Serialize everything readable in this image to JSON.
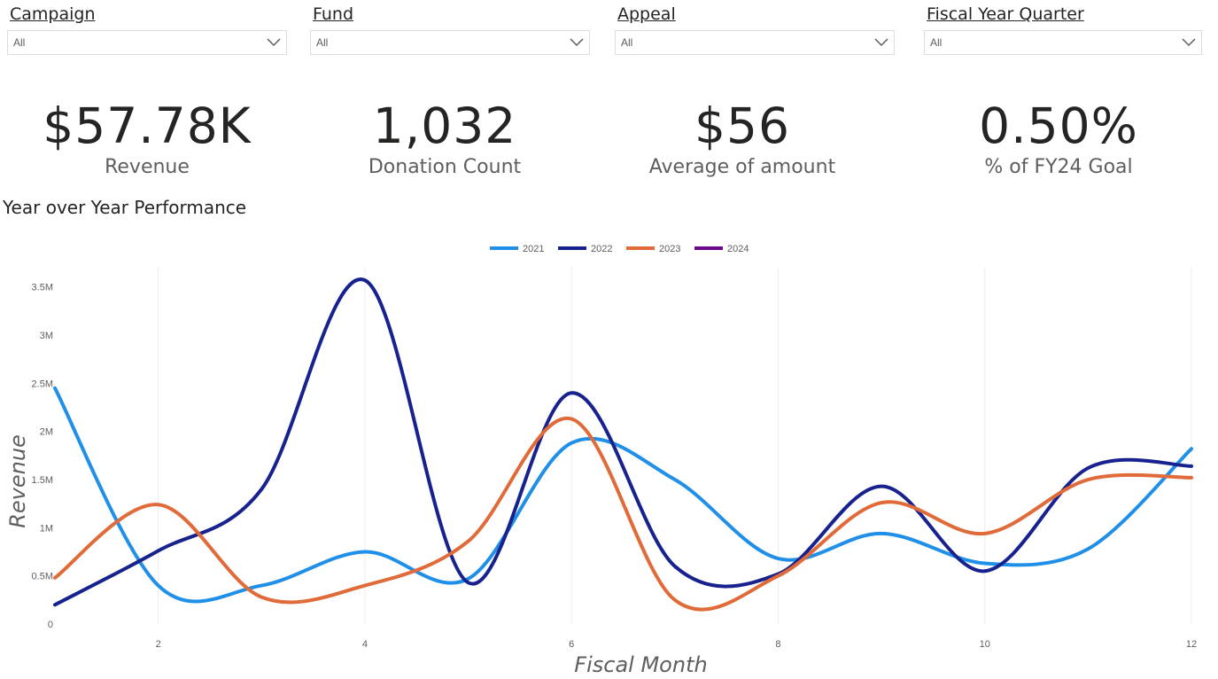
{
  "filters": [
    {
      "label": "Campaign",
      "value": "All"
    },
    {
      "label": "Fund",
      "value": "All"
    },
    {
      "label": "Appeal",
      "value": "All"
    },
    {
      "label": "Fiscal Year Quarter",
      "value": "All"
    }
  ],
  "kpis": [
    {
      "value": "$57.78K",
      "label": "Revenue"
    },
    {
      "value": "1,032",
      "label": "Donation Count"
    },
    {
      "value": "$56",
      "label": "Average of amount"
    },
    {
      "value": "0.50%",
      "label": "% of FY24 Goal"
    }
  ],
  "chart_title": "Year over Year Performance",
  "colors": {
    "2021": "#1f8fe8",
    "2022": "#17228f",
    "2023": "#e06a38",
    "2024": "#6b0a8a"
  },
  "chart_data": {
    "type": "line",
    "x": [
      1,
      2,
      3,
      4,
      5,
      6,
      7,
      8,
      9,
      10,
      11,
      12
    ],
    "xticks": [
      "2",
      "4",
      "6",
      "8",
      "10",
      "12"
    ],
    "xtick_values": [
      2,
      4,
      6,
      8,
      10,
      12
    ],
    "yticks": [
      "0",
      "0.5M",
      "1M",
      "1.5M",
      "2M",
      "2.5M",
      "3M",
      "3.5M"
    ],
    "ytick_values": [
      0,
      0.5,
      1,
      1.5,
      2,
      2.5,
      3,
      3.5
    ],
    "ylim": [
      0,
      3.7
    ],
    "xlim": [
      1,
      12
    ],
    "xlabel": "Fiscal Month",
    "ylabel": "Revenue",
    "legend_position": "top-center",
    "series": [
      {
        "name": "2021",
        "values": [
          2.45,
          0.4,
          0.4,
          0.75,
          0.47,
          1.88,
          1.5,
          0.68,
          0.94,
          0.63,
          0.78,
          1.82
        ]
      },
      {
        "name": "2022",
        "values": [
          0.2,
          0.76,
          1.4,
          3.57,
          0.43,
          2.4,
          0.6,
          0.52,
          1.43,
          0.55,
          1.62,
          1.64
        ]
      },
      {
        "name": "2023",
        "values": [
          0.48,
          1.24,
          0.28,
          0.4,
          0.86,
          2.13,
          0.25,
          0.5,
          1.26,
          0.94,
          1.5,
          1.52
        ]
      },
      {
        "name": "2024",
        "values": []
      }
    ]
  }
}
